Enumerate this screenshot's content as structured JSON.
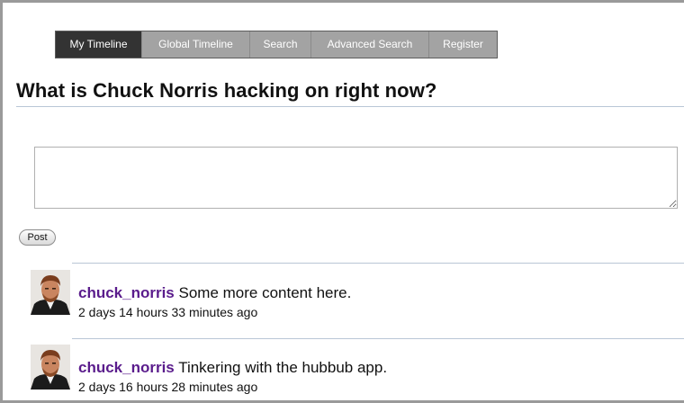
{
  "nav": {
    "tabs": [
      {
        "label": "My Timeline",
        "active": true
      },
      {
        "label": "Global Timeline",
        "active": false
      },
      {
        "label": "Search",
        "active": false
      },
      {
        "label": "Advanced Search",
        "active": false
      },
      {
        "label": "Register",
        "active": false
      }
    ]
  },
  "page_title": "What is Chuck Norris hacking on right now?",
  "composer": {
    "value": "",
    "post_label": "Post"
  },
  "statuses": [
    {
      "username": "chuck_norris",
      "text": "Some more content here.",
      "time": "2 days 14 hours 33 minutes ago",
      "avatar_icon": "user-avatar"
    },
    {
      "username": "chuck_norris",
      "text": "Tinkering with the hubbub app.",
      "time": "2 days 16 hours 28 minutes ago",
      "avatar_icon": "user-avatar"
    }
  ],
  "colors": {
    "nav_active": "#333333",
    "nav_inactive": "#a3a3a3",
    "username": "#5a1c8c",
    "divider": "#b9c6d6"
  }
}
